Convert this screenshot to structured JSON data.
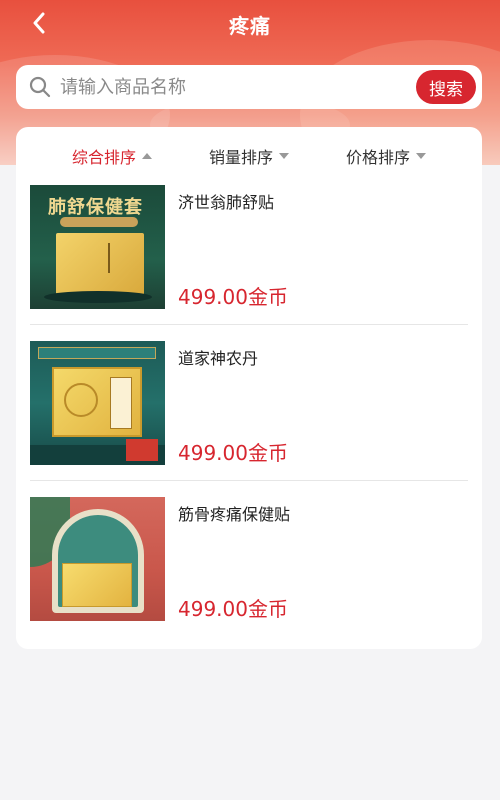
{
  "header": {
    "title": "疼痛"
  },
  "search": {
    "placeholder": "请输入商品名称",
    "button_label": "搜索"
  },
  "sort_tabs": [
    {
      "label": "综合排序",
      "active": true
    },
    {
      "label": "销量排序",
      "active": false
    },
    {
      "label": "价格排序",
      "active": false
    }
  ],
  "products": [
    {
      "name": "济世翁肺舒贴",
      "price": "499.00金币",
      "image_text": "肺舒保健套"
    },
    {
      "name": "道家神农丹",
      "price": "499.00金币"
    },
    {
      "name": "筋骨疼痛保健贴",
      "price": "499.00金币"
    }
  ],
  "colors": {
    "accent": "#d7262f",
    "header": "#e8503e"
  }
}
